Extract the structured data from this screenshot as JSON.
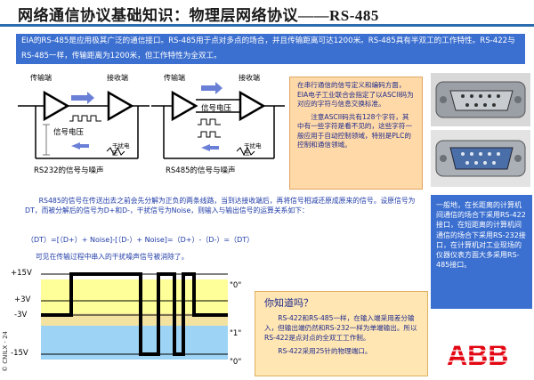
{
  "header": {
    "title": "网络通信协议基础知识：物理层网络协议——RS-485"
  },
  "intro": {
    "text": "EIA的RS-485是应用极其广泛的通信接口。RS-485用于点对多点的场合，并且传输距离可达1200米。RS-485具有半双工的工作特性。RS-422与RS-485一样，传输距离为1200米，但工作特性为全双工。"
  },
  "diagram_rs232": {
    "sender": "传输端",
    "receiver": "接收端",
    "signal_label": "信号电压",
    "noise_label": "干扰电压",
    "caption": "RS232的信号与噪声"
  },
  "diagram_rs485": {
    "sender": "传输端",
    "receiver": "接收端",
    "signal_label": "信号电压",
    "noise_label": "干扰电压",
    "caption": "RS485的信号与噪声"
  },
  "ascii_box": {
    "para1": "在串行通信的信号定义和编码方面，EIA电子工业联合会指定了以ASCII码为对应的字符与信息交换标准。",
    "para2": "注意ASCII码共有128个字符，其中有一些字符是看不见的，这些字符一般应用于自动控制领域，特别是PLC的控制和通信领域。"
  },
  "connectors": {
    "male": "db9-male-connector-icon",
    "female": "db9-female-connector-icon"
  },
  "lan_box": {
    "text": "一般地，在长距离的计算机间通信的场合下采用RS-422接口，在短距离的计算机间通信的场合下采用RS-232接口，在计算机对工业现场的仪器仪表方面大多采用RS-485接口。"
  },
  "explain": {
    "para": "RS485的信号在传送出去之前会先分解为正负的两条线路，当到达接收端后，再将信号相减还原成原来的信号。设原信号为DT，而被分解后的信号为D+和D-，干扰信号为Noise，则输入与输出信号的运算关系如下：",
    "formula": "（DT）=[（D+）+ Noise]-[（D-）+ Noise]=（D+）-（D-）=（DT）",
    "caption": "可见在传输过程中串入的干扰噪声信号被消除了。"
  },
  "waveform": {
    "levels": [
      "+15V",
      "+3V",
      "-3V",
      "-15V"
    ],
    "logic": [
      "\"0\"",
      "\"1\"",
      "\"0\""
    ],
    "colors": {
      "high_band": "#ffff99",
      "low_band": "#9dd3f5",
      "mid_band": "#f4e3a0",
      "signal": "#000000"
    }
  },
  "know_box": {
    "title": "你知道吗？",
    "body": "RS-422和RS-485一样，在输入端采用差分输入，但输出端仍然和RS-232一样为单端输出。所以RS-422是点对点的全双工工作制。",
    "note": "RS-422采用25针的物理端口。"
  },
  "footer": {
    "copyright": "© CNILX - 24",
    "logo": "ABB"
  }
}
